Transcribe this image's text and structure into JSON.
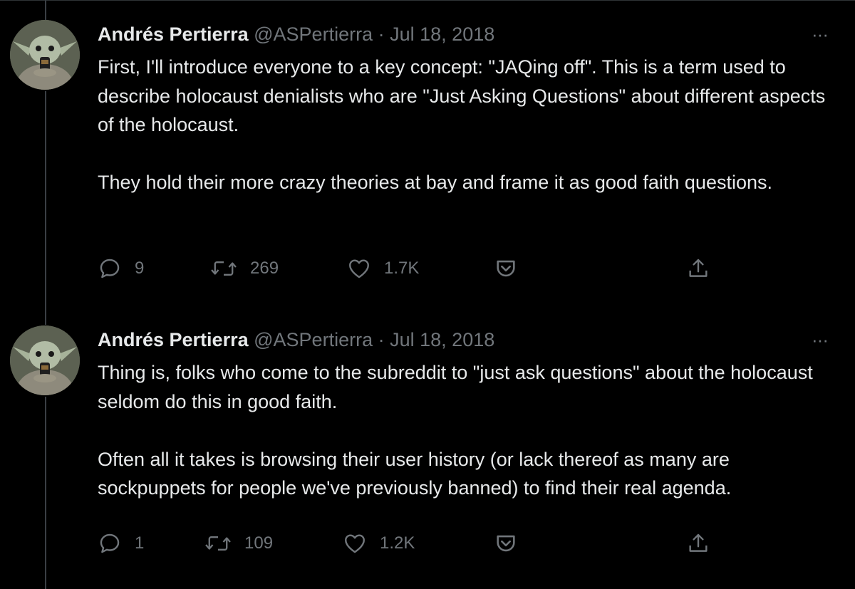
{
  "colors": {
    "background": "#000000",
    "text_primary": "#e7e9ea",
    "text_secondary": "#71767b",
    "thread_line": "#3a3f44"
  },
  "tweets": [
    {
      "author_name": "Andrés Pertierra",
      "handle": "@ASPertierra",
      "separator": "·",
      "date": "Jul 18, 2018",
      "more_label": "···",
      "avatar_icon": "baby-yoda-avatar",
      "paragraphs": [
        "First, I'll introduce everyone to a key concept: \"JAQing off\". This is a term used to describe holocaust denialists who are \"Just Asking Questions\" about different aspects of the holocaust.",
        "They hold their more crazy theories at bay and frame it as good faith questions."
      ],
      "replies": "9",
      "retweets": "269",
      "likes": "1.7K"
    },
    {
      "author_name": "Andrés Pertierra",
      "handle": "@ASPertierra",
      "separator": "·",
      "date": "Jul 18, 2018",
      "more_label": "···",
      "avatar_icon": "baby-yoda-avatar",
      "paragraphs": [
        "Thing is, folks who come to the subreddit to \"just ask questions\" about the holocaust seldom do this in good faith.",
        "Often all it takes is browsing their user history (or lack thereof as many are sockpuppets for people we've previously banned) to find their real agenda."
      ],
      "replies": "1",
      "retweets": "109",
      "likes": "1.2K"
    }
  ]
}
